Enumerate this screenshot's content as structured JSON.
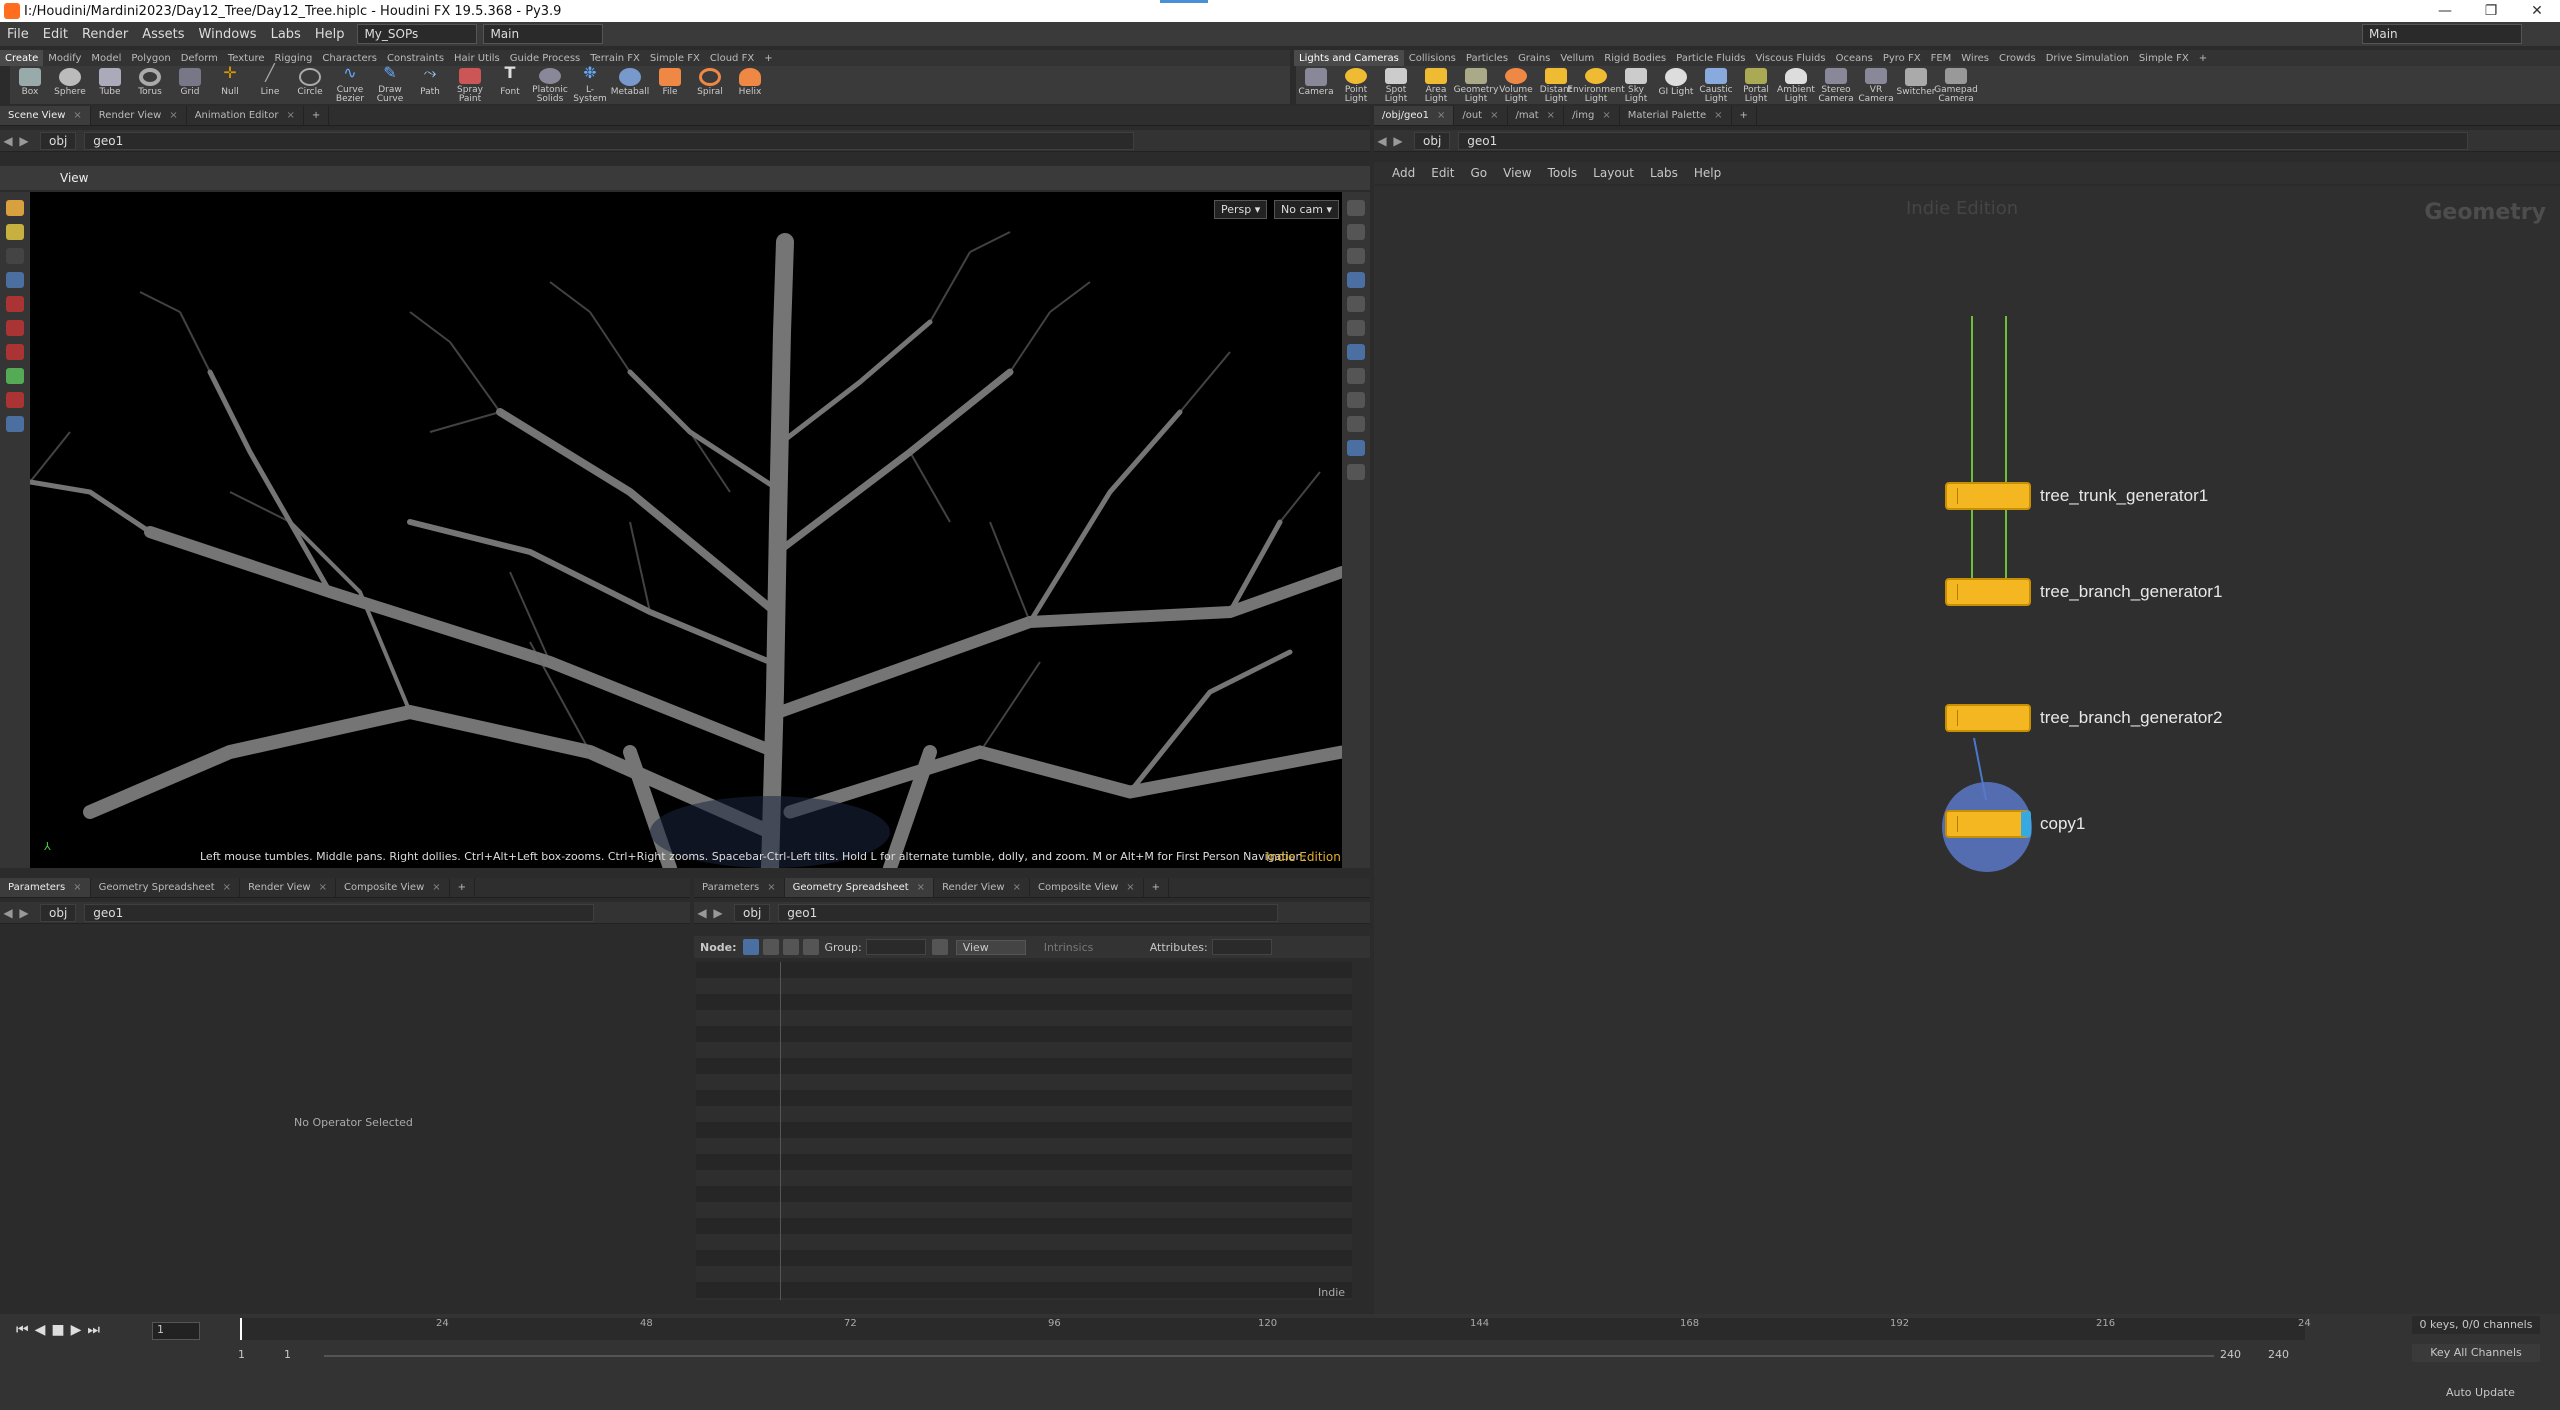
{
  "window": {
    "title": "I:/Houdini/Mardini2023/Day12_Tree/Day12_Tree.hiplc - Houdini FX 19.5.368 - Py3.9",
    "min": "—",
    "max": "❐",
    "close": "✕"
  },
  "menu": {
    "items": [
      "File",
      "Edit",
      "Render",
      "Assets",
      "Windows",
      "Labs",
      "Help"
    ],
    "shelf_set": "My_SOPs",
    "desktop": "Main",
    "desktop_right": "Main"
  },
  "shelf_left": {
    "tabs": [
      "Create",
      "Modify",
      "Model",
      "Polygon",
      "Deform",
      "Texture",
      "Rigging",
      "Characters",
      "Constraints",
      "Hair Utils",
      "Guide Process",
      "Terrain FX",
      "Simple FX",
      "Cloud FX"
    ],
    "tools": [
      "Box",
      "Sphere",
      "Tube",
      "Torus",
      "Grid",
      "Null",
      "Line",
      "Circle",
      "Curve Bezier",
      "Draw Curve",
      "Path",
      "Spray Paint",
      "Font",
      "Platonic Solids",
      "L-System",
      "Metaball",
      "File",
      "Spiral",
      "Helix"
    ]
  },
  "shelf_right": {
    "tabs": [
      "Lights and Cameras",
      "Collisions",
      "Particles",
      "Grains",
      "Vellum",
      "Rigid Bodies",
      "Particle Fluids",
      "Viscous Fluids",
      "Oceans",
      "Pyro FX",
      "FEM",
      "Wires",
      "Crowds",
      "Drive Simulation",
      "Simple FX"
    ],
    "tools": [
      "Camera",
      "Point Light",
      "Spot Light",
      "Area Light",
      "Geometry Light",
      "Volume Light",
      "Distant Light",
      "Environment Light",
      "Sky Light",
      "GI Light",
      "Caustic Light",
      "Portal Light",
      "Ambient Light",
      "Stereo Camera",
      "VR Camera",
      "Switcher",
      "Gamepad Camera"
    ]
  },
  "scene_tabs": [
    "Scene View",
    "Render View",
    "Animation Editor"
  ],
  "net_tabs": [
    "/obj/geo1",
    "/out",
    "/mat",
    "/img",
    "Material Palette"
  ],
  "path": {
    "obj": "obj",
    "geo": "geo1"
  },
  "viewport": {
    "label": "View",
    "persp": "Persp ▾",
    "cam": "No cam ▾",
    "hint": "Left mouse tumbles. Middle pans. Right dollies. Ctrl+Alt+Left box-zooms. Ctrl+Right zooms. Spacebar-Ctrl-Left tilts. Hold L for alternate tumble, dolly, and zoom.    M or Alt+M for First Person Navigation.",
    "edition": "Indie Edition"
  },
  "network": {
    "menu": [
      "Add",
      "Edit",
      "Go",
      "View",
      "Tools",
      "Layout",
      "Labs",
      "Help"
    ],
    "edition": "Indie Edition",
    "context": "Geometry",
    "nodes": [
      "tree_trunk_generator1",
      "tree_branch_generator1",
      "tree_branch_generator2",
      "copy1"
    ]
  },
  "params": {
    "tabs": [
      "Parameters",
      "Geometry Spreadsheet",
      "Render View",
      "Composite View"
    ],
    "empty": "No Operator Selected"
  },
  "spreadsheet": {
    "tabs": [
      "Parameters",
      "Geometry Spreadsheet",
      "Render View",
      "Composite View"
    ],
    "node_label": "Node:",
    "group_label": "Group:",
    "view": "View",
    "intrinsics": "Intrinsics",
    "attributes": "Attributes:",
    "footer": "Indie"
  },
  "timeline": {
    "ticks": [
      "24",
      "48",
      "72",
      "96",
      "120",
      "144",
      "168",
      "192",
      "216",
      "24"
    ],
    "frame": "1",
    "start": "1",
    "start2": "1",
    "end": "240",
    "end2": "240",
    "keys": "0 keys, 0/0 channels",
    "key_all": "Key All Channels",
    "auto_update": "Auto Update"
  }
}
